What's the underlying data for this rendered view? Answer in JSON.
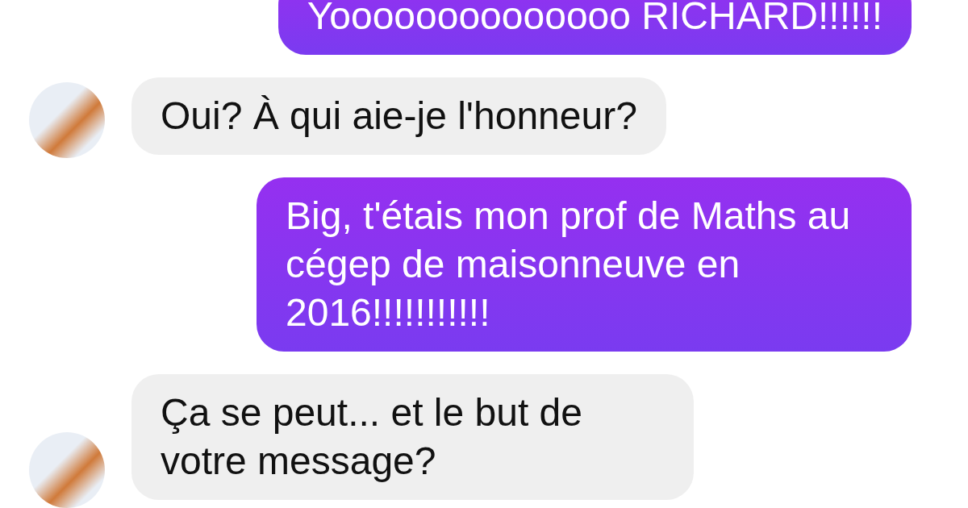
{
  "messages": [
    {
      "kind": "sent",
      "text": "Yoooooooooooooo RICHARD!!!!!!"
    },
    {
      "kind": "received",
      "text": "Oui? À qui aie-je l'honneur?"
    },
    {
      "kind": "sent",
      "text": "Big, t'étais mon prof de Maths au cégep de maisonneuve en 2016!!!!!!!!!!!"
    },
    {
      "kind": "received",
      "text": "Ça se peut... et le but de votre message?"
    }
  ]
}
